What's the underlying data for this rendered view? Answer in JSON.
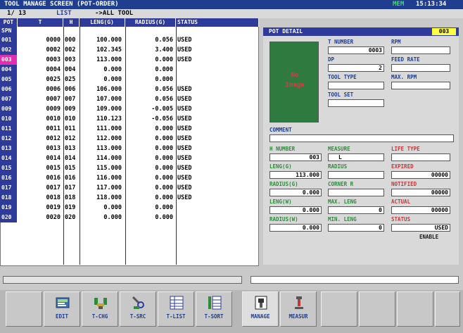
{
  "titlebar": {
    "title": "TOOL MANAGE SCREEN (POT-ORDER)",
    "mem": "MEM",
    "clock": "15:13:34"
  },
  "subbar": {
    "page": "1/ 13",
    "mode": "LIST",
    "filter": "->ALL TOOL"
  },
  "table": {
    "headers": [
      "POT",
      "T",
      "H",
      "LENG(G)",
      "RADIUS(G)",
      "STATUS"
    ],
    "spn_label": "SPN",
    "rows": [
      {
        "pot": "001",
        "t": "0000",
        "h": "000",
        "leng": "100.000",
        "rad": "0.056",
        "status": "USED"
      },
      {
        "pot": "002",
        "t": "0002",
        "h": "002",
        "leng": "102.345",
        "rad": "3.400",
        "status": "USED"
      },
      {
        "pot": "003",
        "t": "0003",
        "h": "003",
        "leng": "113.000",
        "rad": "0.000",
        "status": "USED"
      },
      {
        "pot": "004",
        "t": "0004",
        "h": "004",
        "leng": "0.000",
        "rad": "0.000",
        "status": ""
      },
      {
        "pot": "005",
        "t": "0025",
        "h": "025",
        "leng": "0.000",
        "rad": "0.000",
        "status": ""
      },
      {
        "pot": "006",
        "t": "0006",
        "h": "006",
        "leng": "106.000",
        "rad": "0.056",
        "status": "USED"
      },
      {
        "pot": "007",
        "t": "0007",
        "h": "007",
        "leng": "107.000",
        "rad": "0.056",
        "status": "USED"
      },
      {
        "pot": "009",
        "t": "0009",
        "h": "009",
        "leng": "109.000",
        "rad": "-0.005",
        "status": "USED"
      },
      {
        "pot": "010",
        "t": "0010",
        "h": "010",
        "leng": "110.123",
        "rad": "-0.056",
        "status": "USED"
      },
      {
        "pot": "011",
        "t": "0011",
        "h": "011",
        "leng": "111.000",
        "rad": "0.000",
        "status": "USED"
      },
      {
        "pot": "012",
        "t": "0012",
        "h": "012",
        "leng": "112.000",
        "rad": "0.000",
        "status": "USED"
      },
      {
        "pot": "013",
        "t": "0013",
        "h": "013",
        "leng": "113.000",
        "rad": "0.000",
        "status": "USED"
      },
      {
        "pot": "014",
        "t": "0014",
        "h": "014",
        "leng": "114.000",
        "rad": "0.000",
        "status": "USED"
      },
      {
        "pot": "015",
        "t": "0015",
        "h": "015",
        "leng": "115.000",
        "rad": "0.000",
        "status": "USED"
      },
      {
        "pot": "016",
        "t": "0016",
        "h": "016",
        "leng": "116.000",
        "rad": "0.000",
        "status": "USED"
      },
      {
        "pot": "017",
        "t": "0017",
        "h": "017",
        "leng": "117.000",
        "rad": "0.000",
        "status": "USED"
      },
      {
        "pot": "018",
        "t": "0018",
        "h": "018",
        "leng": "118.000",
        "rad": "0.000",
        "status": "USED"
      },
      {
        "pot": "019",
        "t": "0019",
        "h": "019",
        "leng": "0.000",
        "rad": "0.000",
        "status": ""
      },
      {
        "pot": "020",
        "t": "0020",
        "h": "020",
        "leng": "0.000",
        "rad": "0.000",
        "status": ""
      }
    ]
  },
  "detail": {
    "title": "POT DETAIL",
    "pot": "003",
    "no_image": "No Image",
    "t_number_label": "T NUMBER",
    "t_number": "0003",
    "rpm_label": "RPM",
    "rpm": "",
    "dp_label": "DP",
    "dp": "2",
    "feed_label": "FEED RATE",
    "feed": "",
    "tool_type_label": "TOOL TYPE",
    "tool_type": "",
    "max_rpm_label": "MAX. RPM",
    "max_rpm": "",
    "tool_set_label": "TOOL SET",
    "tool_set": "",
    "comment_label": "COMMENT",
    "comment": "",
    "h_number_label": "H NUMBER",
    "h_number": "003",
    "measure_label": "MEASURE",
    "measure": "L",
    "life_type_label": "LIFE TYPE",
    "life_type": "",
    "leng_g_label": "LENG(G)",
    "leng_g": "113.000",
    "radius_label": "RADIUS",
    "radius": "",
    "expired_label": "EXPIRED",
    "expired": "00000",
    "radius_g_label": "RADIUS(G)",
    "radius_g": "0.000",
    "corner_label": "CORNER R",
    "corner": "",
    "notified_label": "NOTIFIED",
    "notified": "00000",
    "leng_w_label": "LENG(W)",
    "leng_w": "0.000",
    "max_leng_label": "MAX. LENG",
    "max_leng": "0",
    "actual_label": "ACTUAL",
    "actual": "00000",
    "radius_w_label": "RADIUS(W)",
    "radius_w": "0.000",
    "min_leng_label": "MIN. LENG",
    "min_leng": "0",
    "status_label": "STATUS",
    "status": "USED",
    "enable": "ENABLE"
  },
  "softkeys": [
    {
      "label": "EDIT",
      "icon": "edit-icon"
    },
    {
      "label": "T-CHG",
      "icon": "tool-change-icon"
    },
    {
      "label": "T-SRC",
      "icon": "tool-search-icon"
    },
    {
      "label": "T-LIST",
      "icon": "tool-list-icon"
    },
    {
      "label": "T-SORT",
      "icon": "tool-sort-icon"
    },
    {
      "label": "MANAGE",
      "icon": "manage-icon"
    },
    {
      "label": "MEASUR",
      "icon": "measure-icon"
    }
  ],
  "colors": {
    "header": "#2f3b9a",
    "selected_row": "#e030b0",
    "image_bg": "#2f7a3f",
    "pot_badge": "#ffff44"
  }
}
